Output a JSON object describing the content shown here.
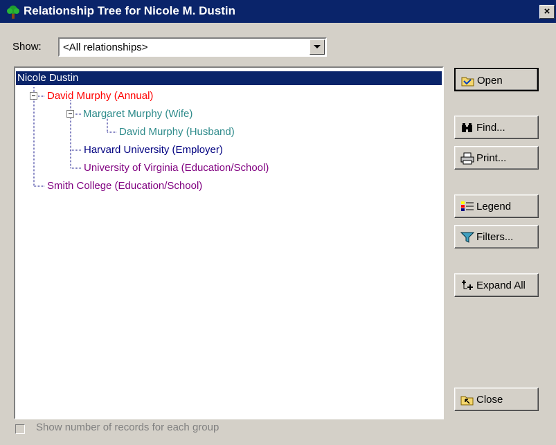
{
  "window": {
    "title": "Relationship Tree for Nicole M. Dustin",
    "close_label": "×"
  },
  "show": {
    "label": "Show:",
    "value": "<All relationships>"
  },
  "tree": {
    "root": "Nicole Dustin",
    "nodes": [
      {
        "label": "David Murphy (Annual)",
        "color": "#ff0000"
      },
      {
        "label": "Margaret Murphy (Wife)",
        "color": "#2e8b8b"
      },
      {
        "label": "David Murphy (Husband)",
        "color": "#2e8b8b"
      },
      {
        "label": "Harvard University (Employer)",
        "color": "#000080"
      },
      {
        "label": "University of Virginia (Education/School)",
        "color": "#800080"
      },
      {
        "label": "Smith College (Education/School)",
        "color": "#800080"
      }
    ]
  },
  "buttons": {
    "open": "Open",
    "find": "Find...",
    "print": "Print...",
    "legend": "Legend",
    "filters": "Filters...",
    "expand_all": "Expand All",
    "close": "Close"
  },
  "footer": {
    "checkbox_label": "Show number of records for each group"
  },
  "icons": [
    "tree-icon",
    "folder-open-icon",
    "binoculars-icon",
    "printer-icon",
    "legend-icon",
    "funnel-icon",
    "expand-plus-icon",
    "folder-close-icon",
    "close-icon",
    "dropdown-arrow-icon"
  ]
}
